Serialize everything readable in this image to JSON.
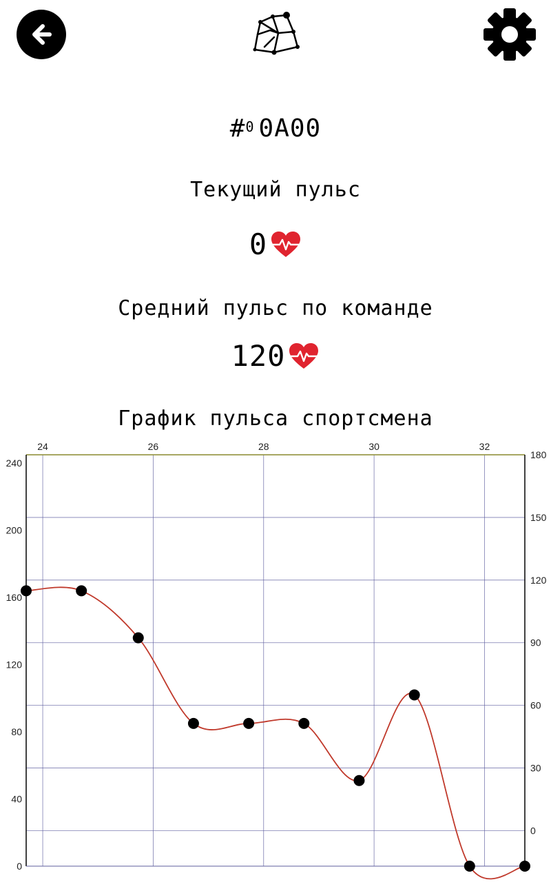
{
  "header": {
    "back_icon": "arrow-left-icon",
    "logo_icon": "constellation-logo-icon",
    "settings_icon": "gear-icon"
  },
  "device": {
    "hash": "#",
    "sub": "0",
    "id": "0A00"
  },
  "current_pulse": {
    "label": "Текущий пульс",
    "value": "0",
    "icon": "heart-pulse-icon"
  },
  "avg_pulse": {
    "label": "Средний пульс по команде",
    "value": "120",
    "icon": "heart-pulse-icon"
  },
  "chart": {
    "title": "График пульса спортсмена",
    "line_color": "#c0392b",
    "grid_color": "#5c5c9e",
    "top_axis_color": "#8a8a2e"
  },
  "chart_data": {
    "type": "line",
    "title": "График пульса спортсмена",
    "x": [
      23.7,
      24.7,
      25.73,
      26.73,
      27.73,
      28.73,
      29.73,
      30.73,
      31.73,
      32.73
    ],
    "values": [
      164,
      164,
      136,
      85,
      85,
      85,
      51,
      102,
      0,
      0
    ],
    "x_ticks": [
      "24",
      "26",
      "28",
      "30",
      "32"
    ],
    "xlim": [
      23.7,
      32.73
    ],
    "ylim_left": [
      0,
      245
    ],
    "y_ticks_left": [
      "0",
      "40",
      "80",
      "120",
      "160",
      "200",
      "240"
    ],
    "ylim_right": [
      -17,
      180
    ],
    "y_ticks_right": [
      "0",
      "30",
      "60",
      "90",
      "120",
      "150",
      "180"
    ],
    "grid": true,
    "smooth": true
  }
}
